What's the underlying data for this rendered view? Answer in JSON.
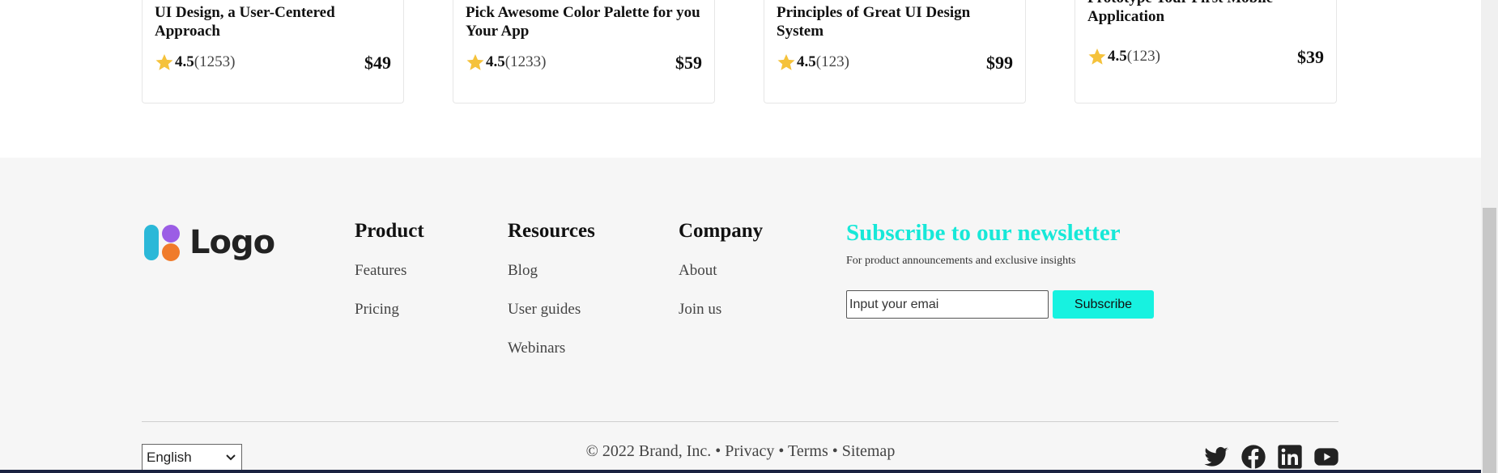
{
  "cards": [
    {
      "title": "UI Design, a User-Centered Approach",
      "rating": "4.5",
      "count": "(1253)",
      "price": "$49"
    },
    {
      "title": "Pick Awesome Color Palette for you Your App",
      "rating": "4.5",
      "count": "(1233)",
      "price": "$59"
    },
    {
      "title": "Principles of Great UI Design System",
      "rating": "4.5",
      "count": "(123)",
      "price": "$99"
    },
    {
      "title": "Prototype Your First Mobile Application",
      "rating": "4.5",
      "count": "(123)",
      "price": "$39"
    }
  ],
  "logo": {
    "text": "Logo"
  },
  "footer": {
    "product": {
      "heading": "Product",
      "links": [
        "Features",
        "Pricing"
      ]
    },
    "resources": {
      "heading": "Resources",
      "links": [
        "Blog",
        "User guides",
        "Webinars"
      ]
    },
    "company": {
      "heading": "Company",
      "links": [
        "About",
        "Join us"
      ]
    }
  },
  "newsletter": {
    "title": "Subscribe to our newsletter",
    "subtitle": "For product announcements and exclusive insights",
    "placeholder": "Input your emai",
    "button": "Subscribe"
  },
  "language": {
    "selected": "English"
  },
  "legal": {
    "copyright": "© 2022 Brand, Inc.",
    "separator": "•",
    "privacy": "Privacy",
    "terms": "Terms",
    "sitemap": "Sitemap"
  },
  "social_icons": [
    "twitter-icon",
    "facebook-icon",
    "linkedin-icon",
    "youtube-icon"
  ],
  "colors": {
    "accent": "#17e8d8",
    "button": "#17f2e0",
    "star": "#f5c23b",
    "footer_bg": "#f6f6f6"
  }
}
